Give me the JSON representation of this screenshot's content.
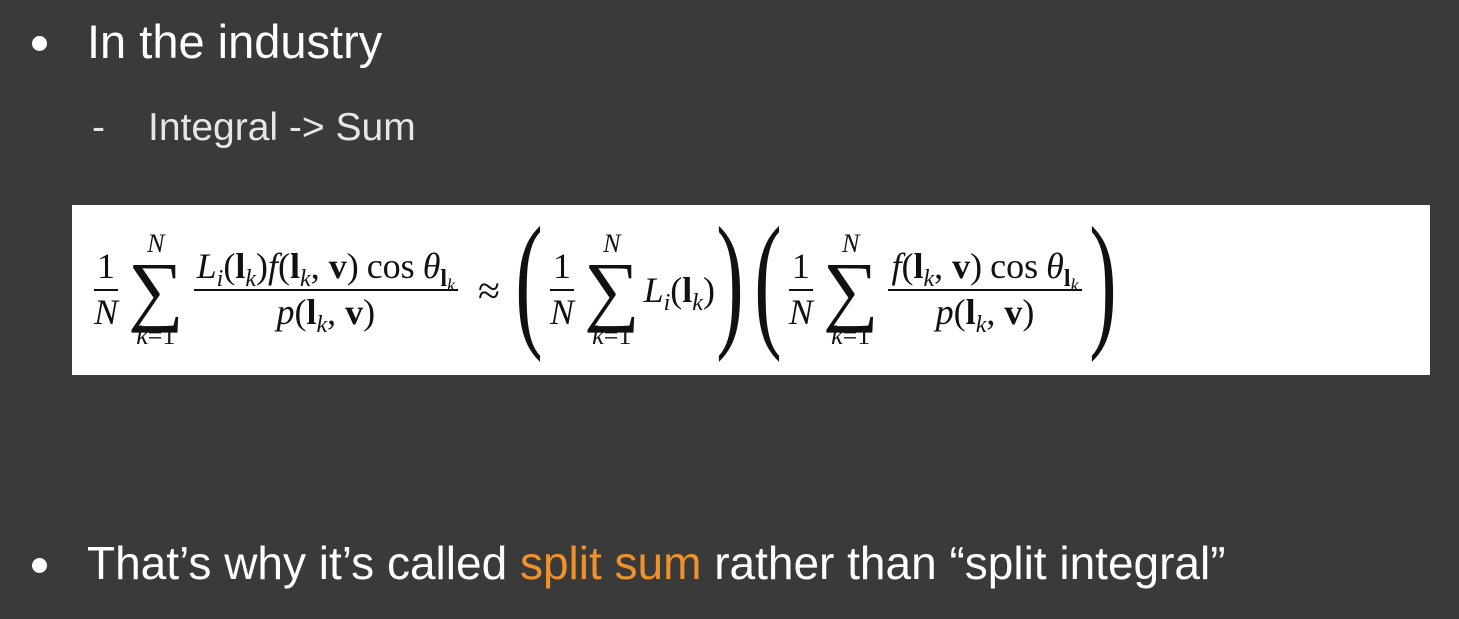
{
  "slide": {
    "bullet1": "In the industry",
    "sub_dash": "-",
    "sub_bullet": "Integral -> Sum",
    "bullet2_before": "That’s why it’s called ",
    "bullet2_highlight": "split sum",
    "bullet2_after": " rather than “split integral”",
    "accent_color": "#f0922b",
    "background_color": "#3a3a3a"
  },
  "formula": {
    "one": "1",
    "N": "N",
    "sigma": "∑",
    "k": "k",
    "eq1": "=1",
    "L": "L",
    "i": "i",
    "l": "l",
    "lp": "(",
    "rp": ")",
    "f": "f",
    "comma": ", ",
    "v": "v",
    "cos": "cos",
    "theta": "θ",
    "p": "p",
    "approx": "≈"
  }
}
